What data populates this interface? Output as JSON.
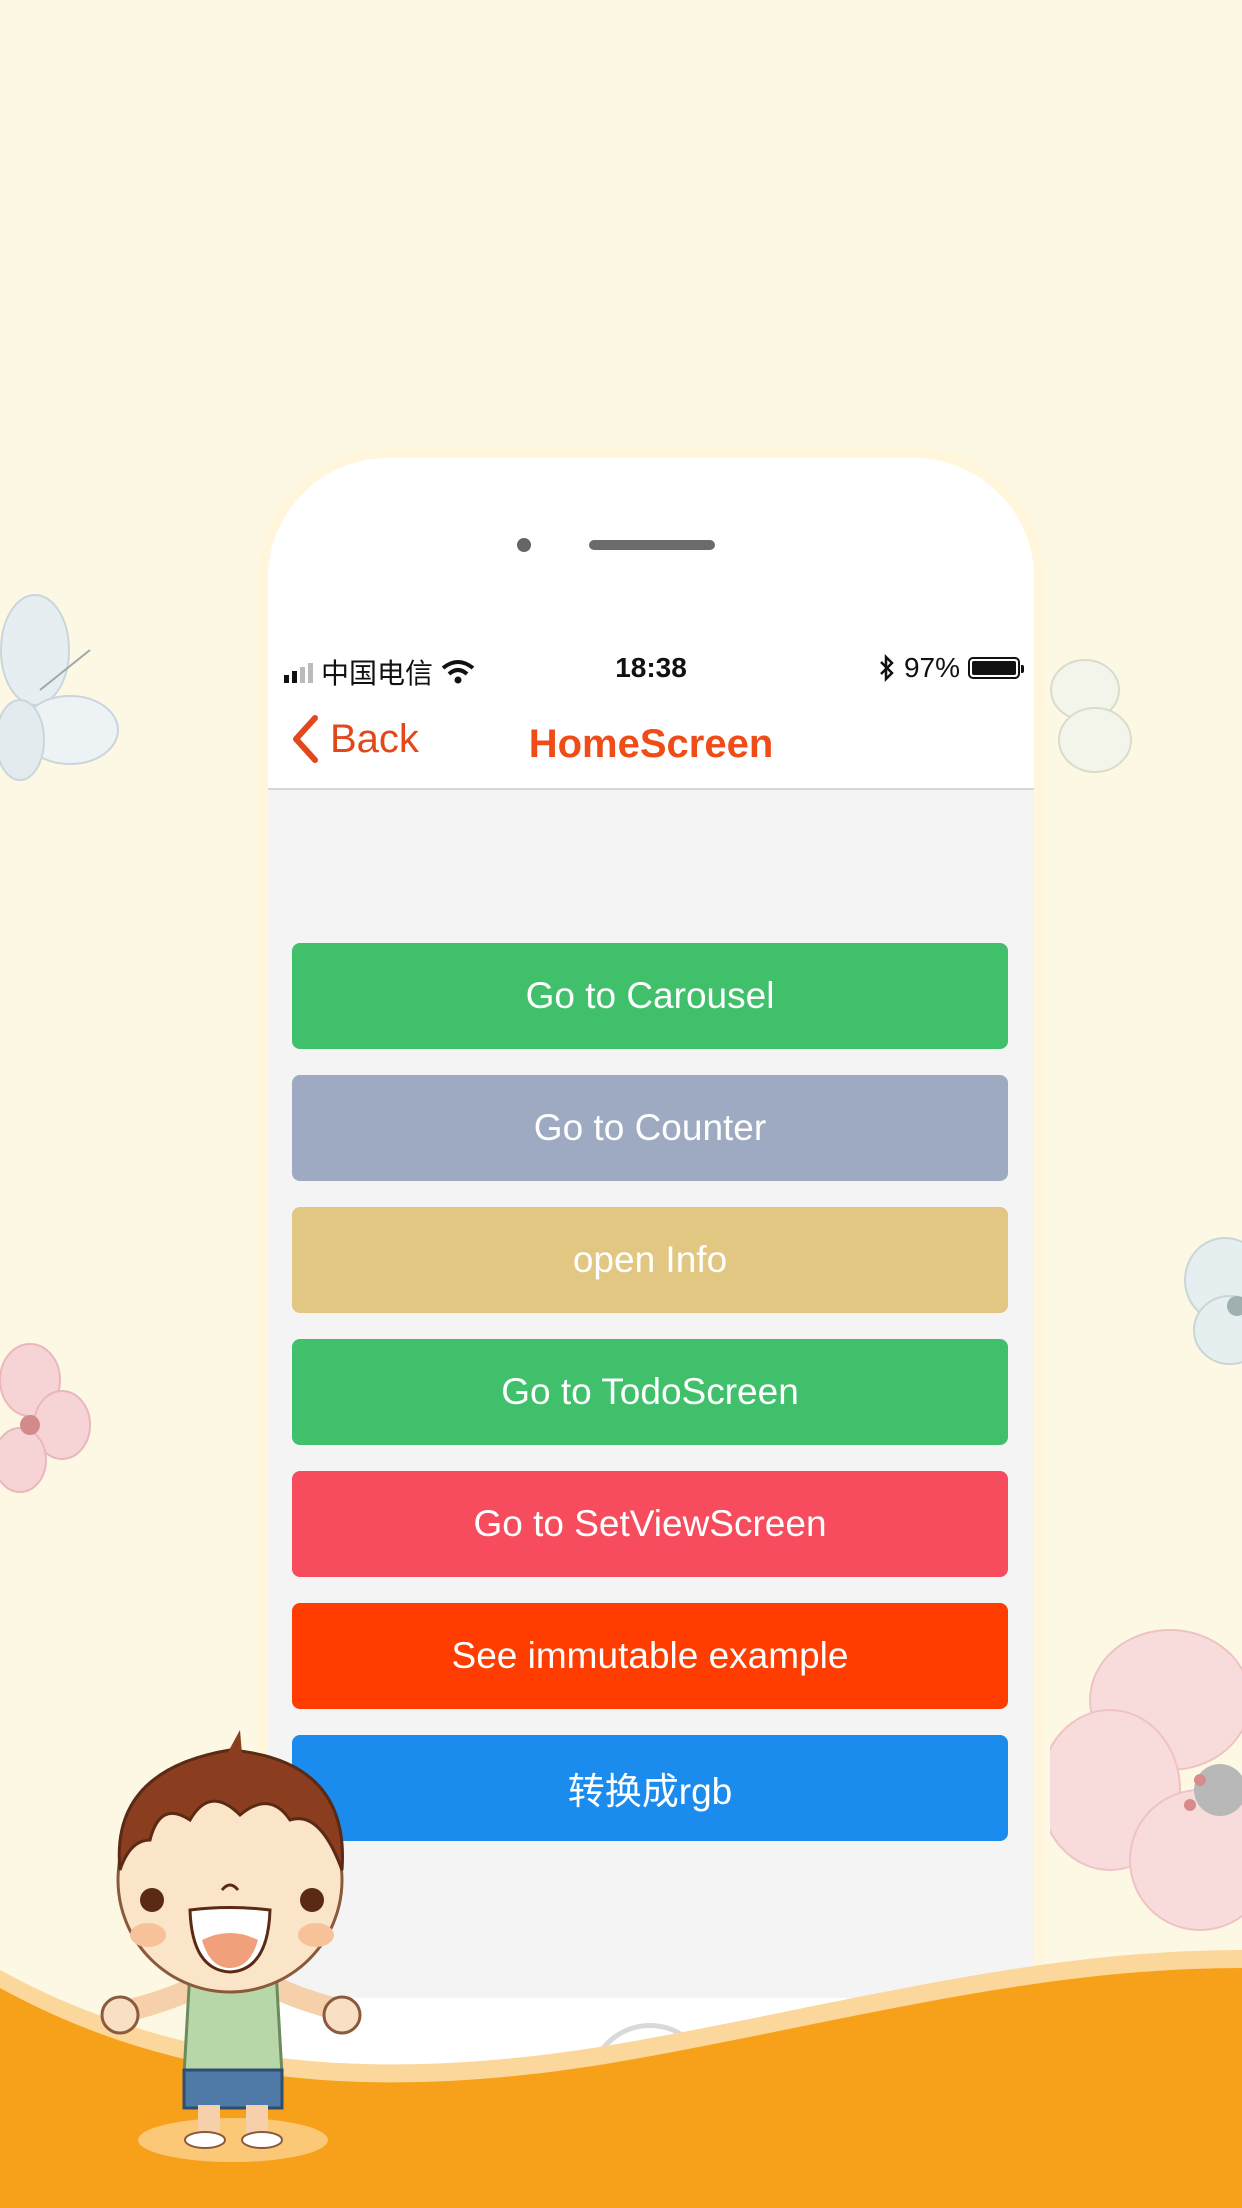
{
  "status_bar": {
    "carrier": "中国电信",
    "time": "18:38",
    "battery": "97%"
  },
  "nav": {
    "back_label": "Back",
    "title": "HomeScreen"
  },
  "buttons": [
    {
      "label": "Go to Carousel",
      "color": "#41c06b"
    },
    {
      "label": "Go to Counter",
      "color": "#9daac2"
    },
    {
      "label": "open Info",
      "color": "#e2c783"
    },
    {
      "label": "Go to TodoScreen",
      "color": "#41c06b"
    },
    {
      "label": "Go to SetViewScreen",
      "color": "#f64c5e"
    },
    {
      "label": "See immutable example",
      "color": "#ff3d00"
    },
    {
      "label": "转换成rgb",
      "color": "#1b8cee"
    }
  ],
  "colors": {
    "background": "#fdf8e4",
    "accent": "#ef4c18",
    "wave": "#f7a11b"
  }
}
